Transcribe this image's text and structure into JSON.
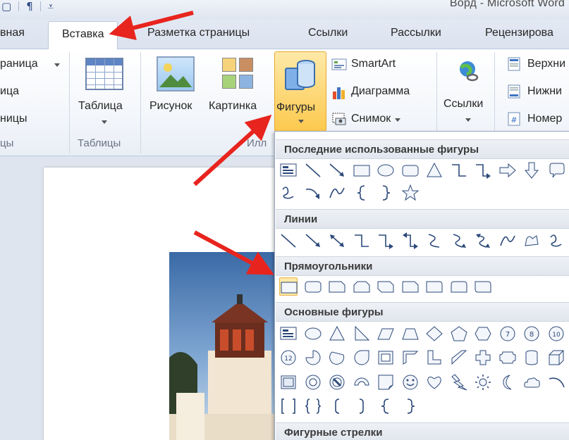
{
  "window": {
    "title": "Ворд - Microsoft Word",
    "qat": [
      "quick-access-save",
      "paragraph-mark",
      "customize"
    ]
  },
  "tabs": [
    {
      "label": "вная",
      "active": false
    },
    {
      "label": "Вставка",
      "active": true
    },
    {
      "label": "Разметка страницы",
      "active": false
    },
    {
      "label": "Ссылки",
      "active": false
    },
    {
      "label": "Рассылки",
      "active": false
    },
    {
      "label": "Рецензирова",
      "active": false
    }
  ],
  "ribbon": {
    "pages_group": {
      "items": [
        "раница",
        "ица",
        "ницы"
      ],
      "label": "цы"
    },
    "tables_group": {
      "button": "Таблица",
      "label": "Таблицы"
    },
    "illustrations_group": {
      "picture": "Рисунок",
      "clipart": "Картинка",
      "shapes": "Фигуры",
      "smartart": "SmartArt",
      "chart": "Диаграмма",
      "screenshot": "Снимок",
      "label": "Илл"
    },
    "links_group": {
      "button": "Ссылки"
    },
    "header_footer_group": {
      "header": "Верхни",
      "footer": "Нижни",
      "page_number": "Номер"
    }
  },
  "shapes_menu": {
    "sections": [
      {
        "title": "Последние использованные фигуры"
      },
      {
        "title": "Линии"
      },
      {
        "title": "Прямоугольники"
      },
      {
        "title": "Основные фигуры"
      },
      {
        "title": "Фигурные стрелки"
      }
    ]
  },
  "colors": {
    "accent_highlight": "#fcc94e",
    "annotation_arrow": "#e8241e",
    "shape_stroke": "#2d4a7a"
  }
}
